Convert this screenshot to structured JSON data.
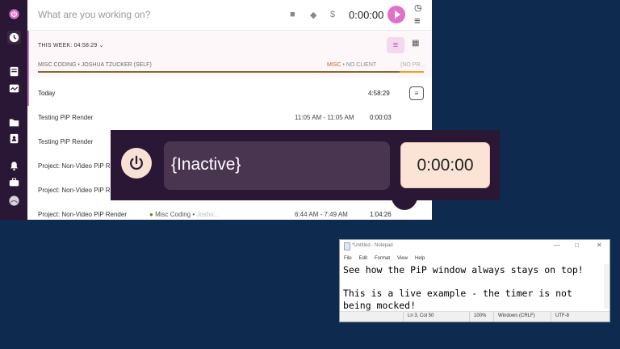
{
  "tracker": {
    "input_placeholder": "What are you working on?",
    "timer": "0:00:00",
    "week_label": "THIS WEEK: 04:58:29",
    "project_left": "MISC CODING",
    "project_left_owner": "JOSHUA TZUCKER (SELF)",
    "project_mid": "MISC",
    "project_mid_client": "NO CLIENT",
    "project_right": "(NO PR...",
    "today_label": "Today",
    "today_total": "4:58:29",
    "entries": [
      {
        "name": "Testing PiP Render",
        "project": "",
        "client": "",
        "range": "11:05 AM - 11:05 AM",
        "duration": "0:00:03"
      },
      {
        "name": "Testing PiP Render",
        "project": "",
        "client": "",
        "range": "",
        "duration": ""
      },
      {
        "name": "Project: Non-Video PiP R...",
        "project": "",
        "client": "",
        "range": "",
        "duration": ""
      },
      {
        "name": "Project: Non-Video PiP R...",
        "project": "",
        "client": "",
        "range": "",
        "duration": ""
      },
      {
        "name": "Project: Non-Video PiP Render",
        "project": "Misc Coding",
        "client": "Joshu...",
        "range": "6:44 AM - 7:49 AM",
        "duration": "1:04:26"
      }
    ]
  },
  "pip": {
    "description": "{Inactive}",
    "timer": "0:00:00"
  },
  "notepad": {
    "title": "*Untitled - Notepad",
    "menu": [
      "File",
      "Edit",
      "Format",
      "View",
      "Help"
    ],
    "lines": [
      "See how the PiP window always stays on top!",
      "",
      "This is a live example - the timer is not",
      "being mocked!"
    ],
    "status_position": "Ln 3, Col 50",
    "status_zoom": "100%",
    "status_eol": "Windows (CRLF)",
    "status_encoding": "UTF-8"
  },
  "colors": {
    "desktop": "#0e2a4f",
    "sidebar": "#2a1735",
    "accent_pink": "#e070c8",
    "pip_timer_bg": "#fbe3d6"
  }
}
